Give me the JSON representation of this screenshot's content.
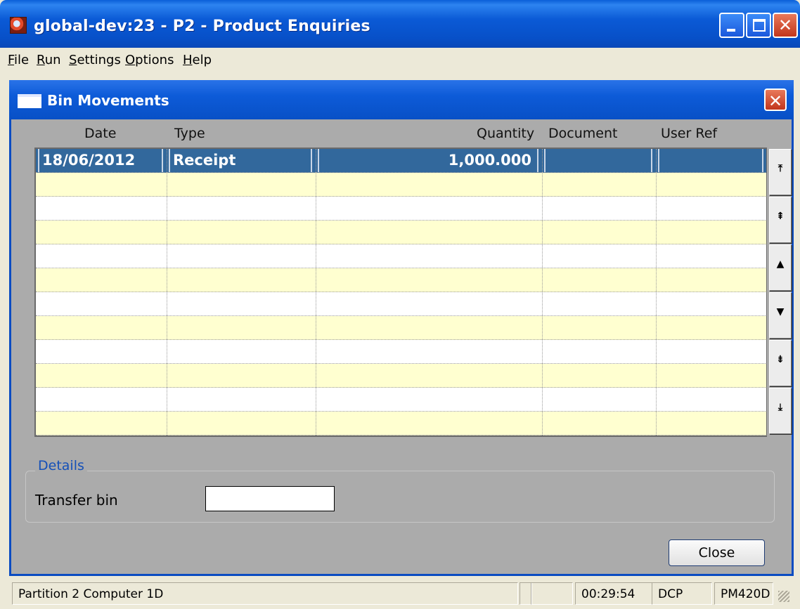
{
  "window": {
    "title": "global-dev:23 - P2 - Product Enquiries"
  },
  "menu": {
    "items": [
      "File",
      "Run",
      "Settings",
      "Options",
      "Help"
    ]
  },
  "dialog": {
    "title": "Bin Movements",
    "columns": [
      "Date",
      "Type",
      "Quantity",
      "Document",
      "User Ref"
    ],
    "rows": [
      {
        "date": "18/06/2012",
        "type": "Receipt",
        "quantity": "1,000.000",
        "document": "",
        "user_ref": "",
        "selected": true
      }
    ],
    "empty_rows": 11,
    "row_colors": [
      "#ffffff",
      "#ffffd0"
    ],
    "selection_color": "#32689c",
    "scroll_buttons": [
      "first-icon",
      "page-up-icon",
      "row-up-icon",
      "row-down-icon",
      "page-down-icon",
      "last-icon"
    ],
    "details": {
      "legend": "Details",
      "transfer_bin_label": "Transfer bin",
      "transfer_bin_value": ""
    },
    "close_label": "Close"
  },
  "statusbar": {
    "left": "Partition 2 Computer 1D",
    "blank1": "",
    "blank2": "",
    "time": "00:29:54",
    "company": "DCP",
    "program": "PM420D"
  }
}
